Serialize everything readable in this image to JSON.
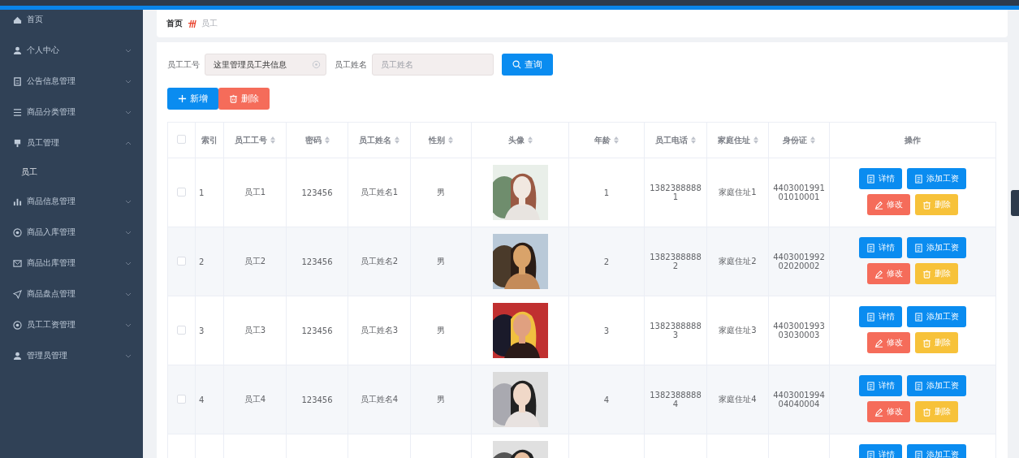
{
  "sidebar": {
    "items": [
      {
        "label": "首页"
      },
      {
        "label": "个人中心",
        "expanded": false
      },
      {
        "label": "公告信息管理",
        "expanded": false
      },
      {
        "label": "商品分类管理",
        "expanded": false
      },
      {
        "label": "员工管理",
        "expanded": true,
        "children": [
          {
            "label": "员工"
          }
        ]
      },
      {
        "label": "商品信息管理",
        "expanded": false
      },
      {
        "label": "商品入库管理",
        "expanded": false
      },
      {
        "label": "商品出库管理",
        "expanded": false
      },
      {
        "label": "商品盘点管理",
        "expanded": false
      },
      {
        "label": "员工工资管理",
        "expanded": false
      },
      {
        "label": "管理员管理",
        "expanded": false
      }
    ]
  },
  "breadcrumb": [
    {
      "label": "首页",
      "current": false
    },
    {
      "label": "员工",
      "current": true
    }
  ],
  "search": {
    "fields": [
      {
        "label": "员工工号",
        "value": "这里管理员工共信息"
      },
      {
        "label": "员工姓名",
        "placeholder": "员工姓名"
      }
    ],
    "button": "查询"
  },
  "toolbar": [
    {
      "label": "新增",
      "kind": "add"
    },
    {
      "label": "删除",
      "kind": "delete"
    }
  ],
  "table": {
    "all_checked": false,
    "columns": [
      {
        "label": "索引",
        "sortable": false
      },
      {
        "label": "员工工号",
        "sortable": true
      },
      {
        "label": "密码",
        "sortable": true
      },
      {
        "label": "员工姓名",
        "sortable": true
      },
      {
        "label": "性别",
        "sortable": true
      },
      {
        "label": "头像",
        "sortable": true
      },
      {
        "label": "年龄",
        "sortable": true
      },
      {
        "label": "员工电话",
        "sortable": true
      },
      {
        "label": "家庭住址",
        "sortable": true
      },
      {
        "label": "身份证",
        "sortable": true
      },
      {
        "label": "操作",
        "sortable": false
      }
    ],
    "rows": [
      {
        "checked": false,
        "cells": [
          "1",
          "员工1",
          "123456",
          "员工姓名1",
          "男",
          "",
          "1",
          "13823888881",
          "家庭住址1",
          "440300199101010001"
        ],
        "actions": [
          "详情",
          "添加工资",
          "修改",
          "删除"
        ]
      },
      {
        "checked": false,
        "cells": [
          "2",
          "员工2",
          "123456",
          "员工姓名2",
          "男",
          "",
          "2",
          "13823888882",
          "家庭住址2",
          "440300199202020002"
        ],
        "actions": [
          "详情",
          "添加工资",
          "修改",
          "删除"
        ]
      },
      {
        "checked": false,
        "cells": [
          "3",
          "员工3",
          "123456",
          "员工姓名3",
          "男",
          "",
          "3",
          "13823888883",
          "家庭住址3",
          "440300199303030003"
        ],
        "actions": [
          "详情",
          "添加工资",
          "修改",
          "删除"
        ]
      },
      {
        "checked": false,
        "cells": [
          "4",
          "员工4",
          "123456",
          "员工姓名4",
          "男",
          "",
          "4",
          "13823888884",
          "家庭住址4",
          "440300199404040004"
        ],
        "actions": [
          "详情",
          "添加工资",
          "修改",
          "删除"
        ]
      },
      {
        "cells": [],
        "actions": [
          "详情",
          "添加工资"
        ]
      }
    ]
  }
}
